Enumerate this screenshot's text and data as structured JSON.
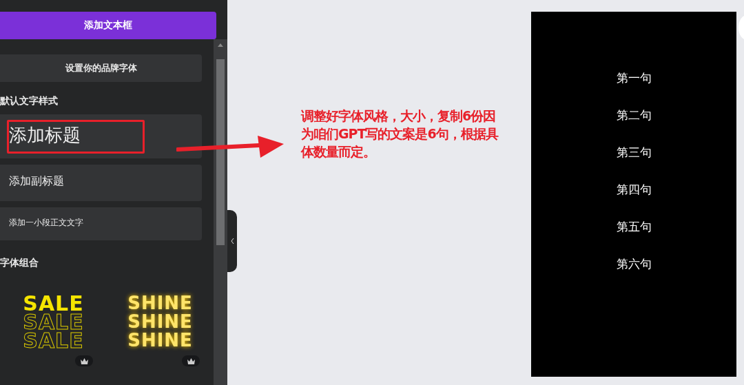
{
  "panel": {
    "add_textbox_button": "添加文本框",
    "brand_font_button": "设置你的品牌字体",
    "default_styles_heading": "默认文字样式",
    "text_styles": [
      {
        "kind": "title",
        "label": "添加标题",
        "highlighted": true
      },
      {
        "kind": "subtitle",
        "label": "添加副标题",
        "highlighted": false
      },
      {
        "kind": "body",
        "label": "添加一小段正文文字",
        "highlighted": false
      }
    ],
    "combos_heading": "字体组合",
    "font_combos": [
      {
        "kind": "outline",
        "lines": [
          "SALE",
          "SALE",
          "SALE"
        ],
        "premium": true
      },
      {
        "kind": "glow",
        "lines": [
          "SHINE",
          "SHINE",
          "SHINE"
        ],
        "premium": true
      }
    ]
  },
  "annotation": {
    "text": "调整好字体风格，大小，复制6份因为咱们GPT写的文案是6句，根据具体数量而定。"
  },
  "canvas": {
    "lines": [
      "第一句",
      "第二句",
      "第三句",
      "第四句",
      "第五句",
      "第六句"
    ]
  }
}
